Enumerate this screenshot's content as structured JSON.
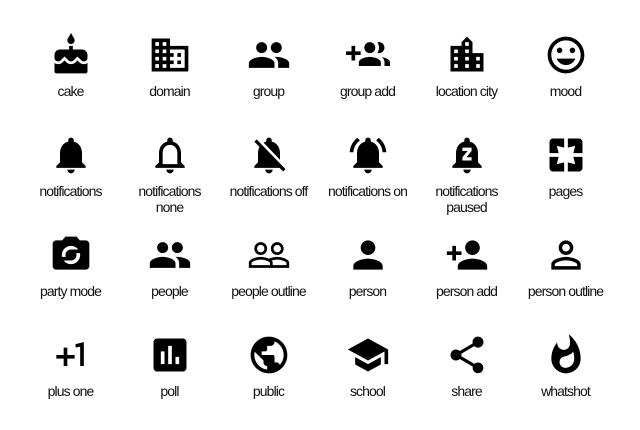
{
  "icons": [
    {
      "id": "cake-icon",
      "label": "cake"
    },
    {
      "id": "domain-icon",
      "label": "domain"
    },
    {
      "id": "group-icon",
      "label": "group"
    },
    {
      "id": "group-add-icon",
      "label": "group add"
    },
    {
      "id": "location-city-icon",
      "label": "location city"
    },
    {
      "id": "mood-icon",
      "label": "mood"
    },
    {
      "id": "notifications-icon",
      "label": "notifications"
    },
    {
      "id": "notifications-none-icon",
      "label": "notifications\nnone"
    },
    {
      "id": "notifications-off-icon",
      "label": "notifications off"
    },
    {
      "id": "notifications-on-icon",
      "label": "notifications on"
    },
    {
      "id": "notifications-paused-icon",
      "label": "notifications\npaused"
    },
    {
      "id": "pages-icon",
      "label": "pages"
    },
    {
      "id": "party-mode-icon",
      "label": "party mode"
    },
    {
      "id": "people-icon",
      "label": "people"
    },
    {
      "id": "people-outline-icon",
      "label": "people outline"
    },
    {
      "id": "person-icon",
      "label": "person"
    },
    {
      "id": "person-add-icon",
      "label": "person add"
    },
    {
      "id": "person-outline-icon",
      "label": "person outline"
    },
    {
      "id": "plus-one-icon",
      "label": "plus one"
    },
    {
      "id": "poll-icon",
      "label": "poll"
    },
    {
      "id": "public-icon",
      "label": "public"
    },
    {
      "id": "school-icon",
      "label": "school"
    },
    {
      "id": "share-icon",
      "label": "share"
    },
    {
      "id": "whatshot-icon",
      "label": "whatshot"
    }
  ]
}
